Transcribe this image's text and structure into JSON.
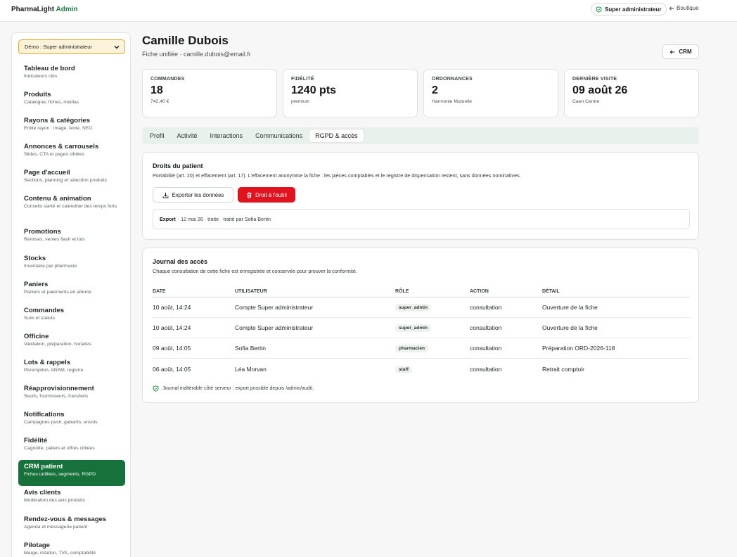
{
  "brand": {
    "name": "PharmaLight",
    "accent": "Admin"
  },
  "topbar": {
    "role_label": "Super administrateur",
    "shop_link": "Boutique"
  },
  "sidebar": {
    "demo_select": "Démo : Super administrateur",
    "items": [
      {
        "title": "Tableau de bord",
        "subtitle": "Indicateurs clés"
      },
      {
        "title": "Produits",
        "subtitle": "Catalogue, fiches, médias"
      },
      {
        "title": "Rayons & catégories",
        "subtitle": "Entité rayon : image, texte, SEO"
      },
      {
        "title": "Annonces & carrousels",
        "subtitle": "Slides, CTA et pages ciblées"
      },
      {
        "title": "Page d'accueil",
        "subtitle": "Sections, planning et sélection produits"
      },
      {
        "title": "Contenu & animation",
        "subtitle": "Conseils santé et calendrier des temps forts"
      },
      {
        "title": "Promotions",
        "subtitle": "Remises, ventes flash et lots"
      },
      {
        "title": "Stocks",
        "subtitle": "Inventaire par pharmacie"
      },
      {
        "title": "Paniers",
        "subtitle": "Paniers et paiements en attente"
      },
      {
        "title": "Commandes",
        "subtitle": "Suivi et statuts"
      },
      {
        "title": "Officine",
        "subtitle": "Validation, préparation, horaires"
      },
      {
        "title": "Lots & rappels",
        "subtitle": "Péremption, ANSM, registre"
      },
      {
        "title": "Réapprovisionnement",
        "subtitle": "Seuils, fournisseurs, transferts"
      },
      {
        "title": "Notifications",
        "subtitle": "Campagnes push, gabarits, envois"
      },
      {
        "title": "Fidélité",
        "subtitle": "Cagnotte, paliers et offres ciblées"
      },
      {
        "title": "CRM patient",
        "subtitle": "Fiches unifiées, segments, RGPD",
        "active": true
      },
      {
        "title": "Avis clients",
        "subtitle": "Modération des avis produits"
      },
      {
        "title": "Rendez-vous & messages",
        "subtitle": "Agenda et messagerie patient"
      },
      {
        "title": "Pilotage",
        "subtitle": "Marge, rotation, TVA, comptabilité"
      }
    ]
  },
  "patient": {
    "name": "Camille Dubois",
    "subtitle": "Fiche unifiée · camille.dubois@email.fr",
    "back_button": "CRM"
  },
  "stats": [
    {
      "label": "COMMANDES",
      "value": "18",
      "sub": "742,40 €"
    },
    {
      "label": "FIDÉLITÉ",
      "value": "1240 pts",
      "sub": "premium"
    },
    {
      "label": "ORDONNANCES",
      "value": "2",
      "sub": "Harmonie Mutuelle"
    },
    {
      "label": "DERNIÈRE VISITE",
      "value": "09 août 26",
      "sub": "Caen Centre"
    }
  ],
  "tabs": [
    {
      "label": "Profil"
    },
    {
      "label": "Activité"
    },
    {
      "label": "Interactions"
    },
    {
      "label": "Communications"
    },
    {
      "label": "RGPD & accès",
      "active": true
    }
  ],
  "rights": {
    "title": "Droits du patient",
    "description": "Portabilité (art. 20) et effacement (art. 17). L'effacement anonymise la fiche : les pièces comptables et le registre de dispensation restent, sans données nominatives.",
    "export_button": "Exporter les données",
    "forget_button": "Droit à l'oubli",
    "export_entry": {
      "type": "Export",
      "detail": "· 12 mai 26 · traite · traité par Sofia Bertin"
    }
  },
  "journal": {
    "title": "Journal des accès",
    "description": "Chaque consultation de cette fiche est enregistrée et conservée pour prouver la conformité.",
    "columns": [
      "DATE",
      "UTILISATEUR",
      "RÔLE",
      "ACTION",
      "DÉTAIL"
    ],
    "rows": [
      {
        "date": "10 août, 14:24",
        "user": "Compte Super administrateur",
        "role": "super_admin",
        "action": "consultation",
        "detail": "Ouverture de la fiche"
      },
      {
        "date": "10 août, 14:24",
        "user": "Compte Super administrateur",
        "role": "super_admin",
        "action": "consultation",
        "detail": "Ouverture de la fiche"
      },
      {
        "date": "09 août, 14:05",
        "user": "Sofia Bertin",
        "role": "pharmacien",
        "action": "consultation",
        "detail": "Préparation ORD-2026-118"
      },
      {
        "date": "06 août, 14:05",
        "user": "Léa Morvan",
        "role": "staff",
        "action": "consultation",
        "detail": "Retrait comptoir"
      }
    ],
    "footer": "Journal inaltérable côté serveur ; export possible depuis /admin/audit."
  },
  "colors": {
    "accent": "#14803e",
    "active_nav": "#16723a",
    "danger": "#e0131f",
    "warning_border": "#e7a52a"
  }
}
